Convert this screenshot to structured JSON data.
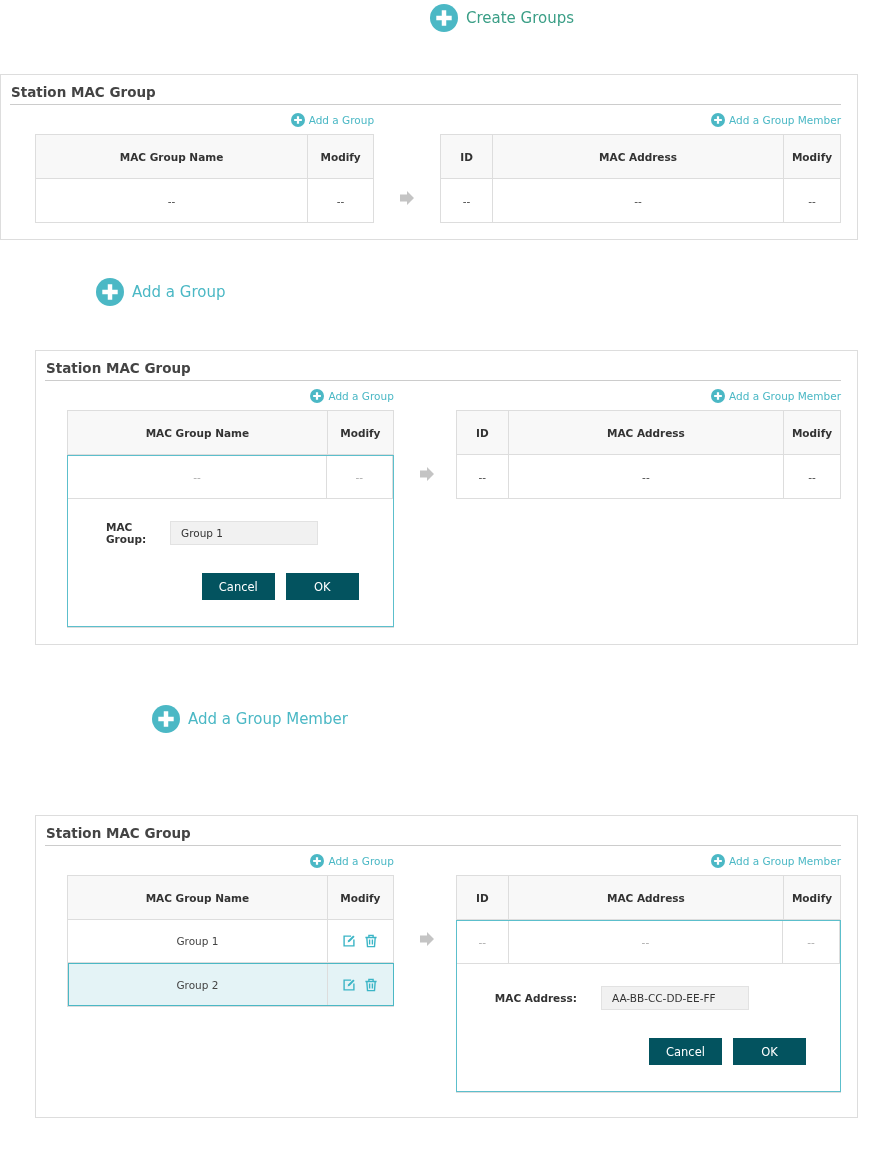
{
  "sections": [
    {
      "kind": "big_link",
      "label": "Create Groups"
    },
    {
      "kind": "panel",
      "title": "Station MAC Group",
      "add_group": "Add a Group",
      "add_member": "Add a Group Member",
      "groups": {
        "columns": [
          "MAC Group Name",
          "Modify"
        ],
        "rows": [
          {
            "cells": [
              "--",
              "--"
            ],
            "selected": false
          }
        ]
      },
      "members": {
        "columns": [
          "ID",
          "MAC Address",
          "Modify"
        ],
        "rows": [
          {
            "cells": [
              "--",
              "--",
              "--"
            ],
            "selected": false
          }
        ]
      }
    },
    {
      "kind": "big_link",
      "label": "Add a Group"
    },
    {
      "kind": "panel",
      "title": "Station MAC Group",
      "add_group": "Add a Group",
      "add_member": "Add a Group Member",
      "groups": {
        "columns": [
          "MAC Group Name",
          "Modify"
        ],
        "rows": [
          {
            "cells": [
              "--",
              "--"
            ],
            "selected": false
          }
        ],
        "editor": {
          "label": "MAC Group:",
          "value": "Group 1",
          "buttons": [
            "Cancel",
            "OK"
          ]
        }
      },
      "members": {
        "columns": [
          "ID",
          "MAC Address",
          "Modify"
        ],
        "rows": [
          {
            "cells": [
              "--",
              "--",
              "--"
            ],
            "selected": false
          }
        ]
      }
    },
    {
      "kind": "big_link",
      "label": "Add a Group Member"
    },
    {
      "kind": "panel",
      "title": "Station MAC Group",
      "add_group": "Add a Group",
      "add_member": "Add a Group Member",
      "groups": {
        "columns": [
          "MAC Group Name",
          "Modify"
        ],
        "rows": [
          {
            "cells": [
              "Group 1"
            ],
            "actions": true,
            "selected": false
          },
          {
            "cells": [
              "Group 2"
            ],
            "actions": true,
            "selected": true
          }
        ]
      },
      "members": {
        "columns": [
          "ID",
          "MAC Address",
          "Modify"
        ],
        "rows": [
          {
            "cells": [
              "--",
              "--",
              "--"
            ],
            "selected": false
          }
        ],
        "editor": {
          "label": "MAC Address:",
          "value": "AA-BB-CC-DD-EE-FF",
          "buttons": [
            "Cancel",
            "OK"
          ]
        }
      }
    }
  ]
}
